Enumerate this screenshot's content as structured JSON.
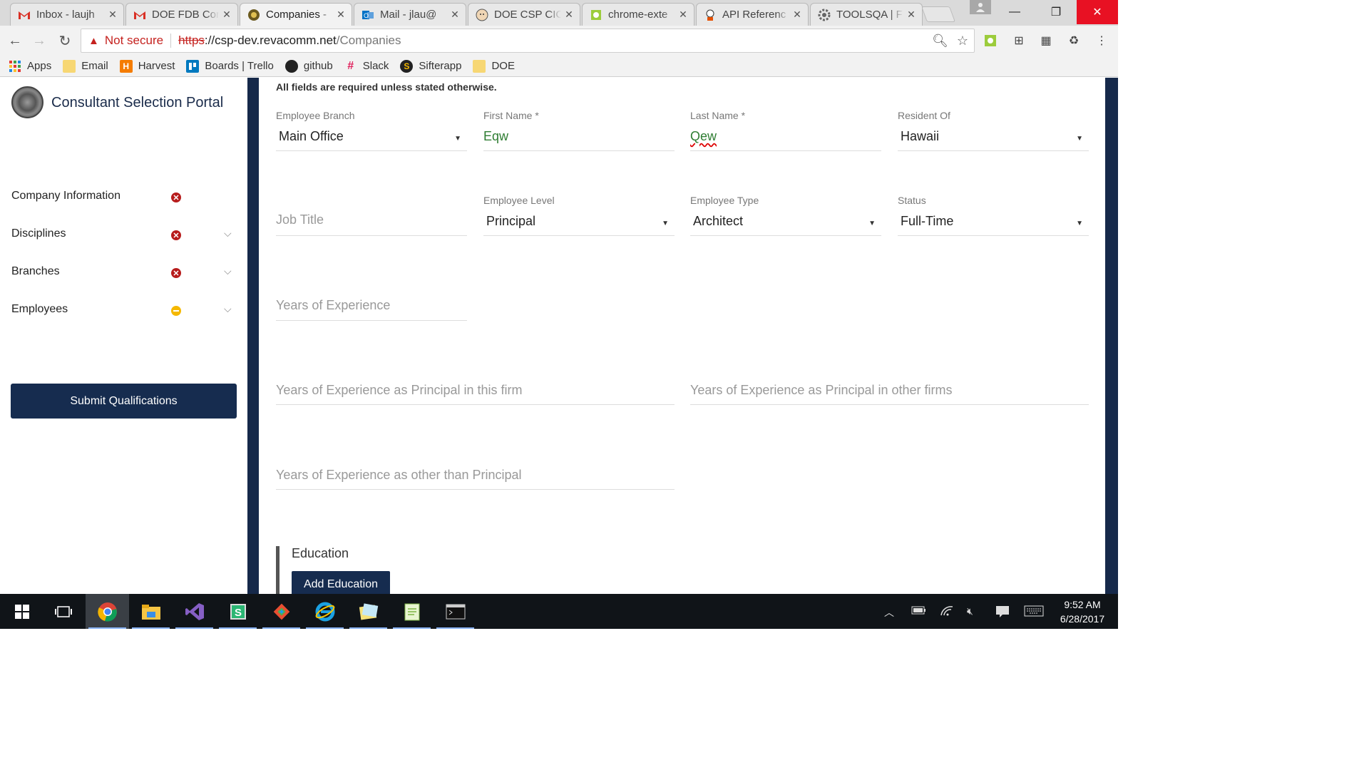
{
  "browser": {
    "tabs": [
      {
        "title": "Inbox - laujh",
        "icon": "gmail-icon"
      },
      {
        "title": "DOE FDB Cor",
        "icon": "gmail-icon"
      },
      {
        "title": "Companies -",
        "icon": "portal-icon"
      },
      {
        "title": "Mail - jlau@",
        "icon": "outlook-icon"
      },
      {
        "title": "DOE CSP CIC",
        "icon": "jenkins-icon"
      },
      {
        "title": "chrome-exte",
        "icon": "extension-icon"
      },
      {
        "title": "API Referenc",
        "icon": "api-icon"
      },
      {
        "title": "TOOLSQA | F",
        "icon": "gear-icon"
      }
    ],
    "security_label": "Not secure",
    "url_scheme": "https",
    "url_host": "://csp-dev.revacomm.net",
    "url_path": "/Companies",
    "bookmarks": [
      {
        "label": "Apps",
        "icon": "apps-grid-icon",
        "color": "#f4b400"
      },
      {
        "label": "Email",
        "icon": "folder-icon",
        "color": "#f7d774"
      },
      {
        "label": "Harvest",
        "icon": "harvest-icon",
        "color": "#f57c00"
      },
      {
        "label": "Boards | Trello",
        "icon": "trello-icon",
        "color": "#0079bf"
      },
      {
        "label": "github",
        "icon": "github-icon",
        "color": "#222222"
      },
      {
        "label": "Slack",
        "icon": "slack-icon",
        "color": "#4a154b"
      },
      {
        "label": "Sifterapp",
        "icon": "sifter-icon",
        "color": "#222222"
      },
      {
        "label": "DOE",
        "icon": "folder-icon",
        "color": "#f7d774"
      }
    ]
  },
  "sidebar": {
    "title": "Consultant Selection Portal",
    "items": [
      {
        "label": "Company Information",
        "status": "error",
        "expandable": false
      },
      {
        "label": "Disciplines",
        "status": "error",
        "expandable": true
      },
      {
        "label": "Branches",
        "status": "error",
        "expandable": true
      },
      {
        "label": "Employees",
        "status": "partial",
        "expandable": true
      }
    ],
    "submit_label": "Submit Qualifications"
  },
  "form": {
    "notice": "All fields are required unless stated otherwise.",
    "employee_branch": {
      "label": "Employee Branch",
      "value": "Main Office"
    },
    "first_name": {
      "label": "First Name *",
      "value": "Eqw"
    },
    "last_name": {
      "label": "Last Name *",
      "value": "Qew"
    },
    "resident_of": {
      "label": "Resident Of",
      "value": "Hawaii"
    },
    "job_title": {
      "placeholder": "Job Title"
    },
    "employee_level": {
      "label": "Employee Level",
      "value": "Principal"
    },
    "employee_type": {
      "label": "Employee Type",
      "value": "Architect"
    },
    "status": {
      "label": "Status",
      "value": "Full-Time"
    },
    "years_experience": {
      "placeholder": "Years of Experience"
    },
    "years_principal_this": {
      "placeholder": "Years of Experience as Principal in this firm"
    },
    "years_principal_other": {
      "placeholder": "Years of Experience as Principal in other firms"
    },
    "years_other_than_principal": {
      "placeholder": "Years of Experience as other than Principal"
    },
    "education_title": "Education",
    "add_education_label": "Add Education"
  },
  "taskbar": {
    "apps": [
      "windows-start-icon",
      "task-view-icon",
      "chrome-icon",
      "file-explorer-icon",
      "visual-studio-icon",
      "sublime-icon",
      "git-icon",
      "internet-explorer-icon",
      "sticky-notes-icon",
      "notepad-plus-icon",
      "terminal-icon"
    ],
    "time": "9:52 AM",
    "date": "6/28/2017"
  },
  "colors": {
    "navy": "#162c4f",
    "error_red": "#b71c1c",
    "warning_yellow": "#f5b800",
    "green_value": "#2e7d32"
  }
}
